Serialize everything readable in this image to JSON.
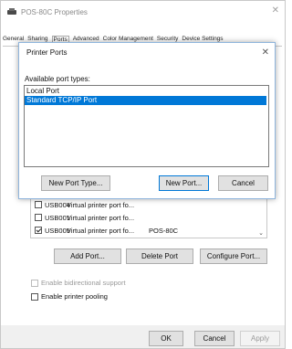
{
  "window": {
    "title": "POS-80C Properties",
    "close_glyph": "✕"
  },
  "tabs": [
    "General",
    "Sharing",
    "Ports",
    "Advanced",
    "Color Management",
    "Security",
    "Device Settings"
  ],
  "active_tab": "Ports",
  "dialog": {
    "title": "Printer Ports",
    "close_glyph": "✕",
    "available_label": "Available port types:",
    "port_types": [
      "Local Port",
      "Standard TCP/IP Port"
    ],
    "selected_port_type": "Standard TCP/IP Port",
    "buttons": {
      "new_port_type": "New Port Type...",
      "new_port": "New Port...",
      "cancel": "Cancel"
    }
  },
  "ports_list": {
    "rows": [
      {
        "checked": false,
        "port": "USB004",
        "description": "Virtual printer port fo...",
        "printer": ""
      },
      {
        "checked": false,
        "port": "USB001",
        "description": "Virtual printer port fo...",
        "printer": ""
      },
      {
        "checked": true,
        "port": "USB005",
        "description": "Virtual printer port fo...",
        "printer": "POS-80C"
      }
    ],
    "scroll_glyph": "⌄"
  },
  "port_buttons": {
    "add": "Add Port...",
    "delete": "Delete Port",
    "configure": "Configure Port..."
  },
  "options": {
    "bidirectional": {
      "label": "Enable bidirectional support",
      "checked": false,
      "enabled": false
    },
    "pooling": {
      "label": "Enable printer pooling",
      "checked": false,
      "enabled": true
    }
  },
  "footer_buttons": {
    "ok": "OK",
    "cancel": "Cancel",
    "apply": "Apply"
  }
}
